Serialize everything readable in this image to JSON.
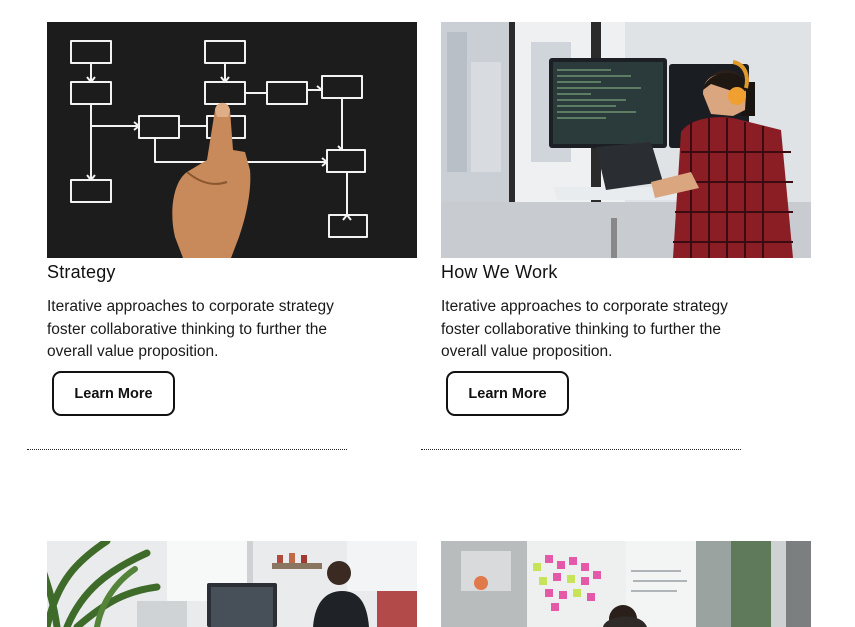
{
  "cards": [
    {
      "image": "flowchart-hand-photo",
      "title": "Strategy",
      "description": "Iterative approaches to corporate strategy foster collaborative thinking to further the overall value proposition.",
      "button_label": "Learn More"
    },
    {
      "image": "developer-at-standing-desk-photo",
      "title": "How We Work",
      "description": "Iterative approaches to corporate strategy foster collaborative thinking to further the overall value proposition.",
      "button_label": "Learn More"
    }
  ],
  "bottom_images": [
    {
      "image": "office-workspace-photo"
    },
    {
      "image": "sticky-notes-meeting-photo"
    }
  ]
}
